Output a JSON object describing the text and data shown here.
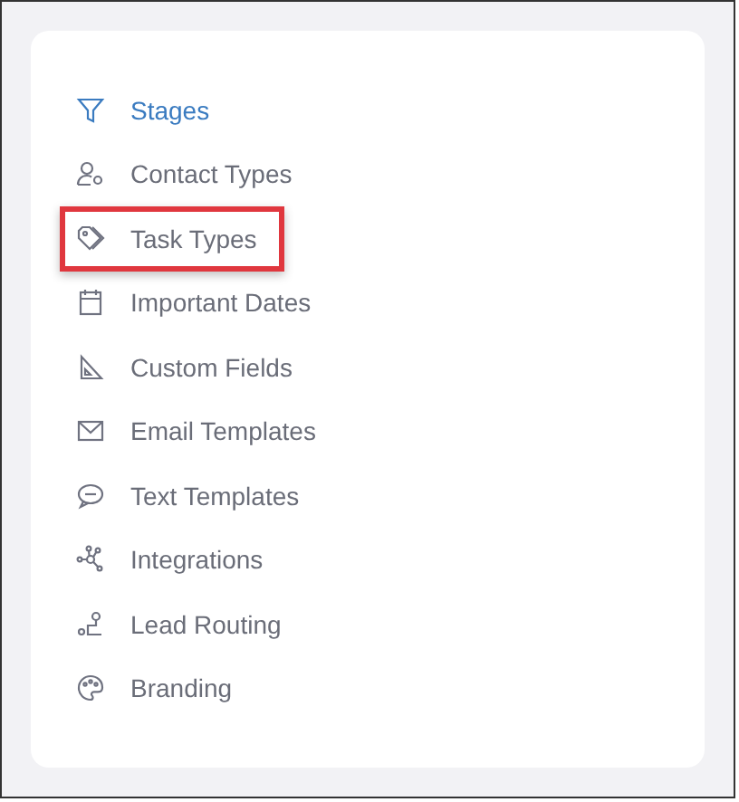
{
  "menu": [
    {
      "label": "Stages",
      "selected": true,
      "highlighted": false
    },
    {
      "label": "Contact Types",
      "selected": false,
      "highlighted": false
    },
    {
      "label": "Task Types",
      "selected": false,
      "highlighted": true
    },
    {
      "label": "Important Dates",
      "selected": false,
      "highlighted": false
    },
    {
      "label": "Custom Fields",
      "selected": false,
      "highlighted": false
    },
    {
      "label": "Email Templates",
      "selected": false,
      "highlighted": false
    },
    {
      "label": "Text Templates",
      "selected": false,
      "highlighted": false
    },
    {
      "label": "Integrations",
      "selected": false,
      "highlighted": false
    },
    {
      "label": "Lead Routing",
      "selected": false,
      "highlighted": false
    },
    {
      "label": "Branding",
      "selected": false,
      "highlighted": false
    }
  ]
}
